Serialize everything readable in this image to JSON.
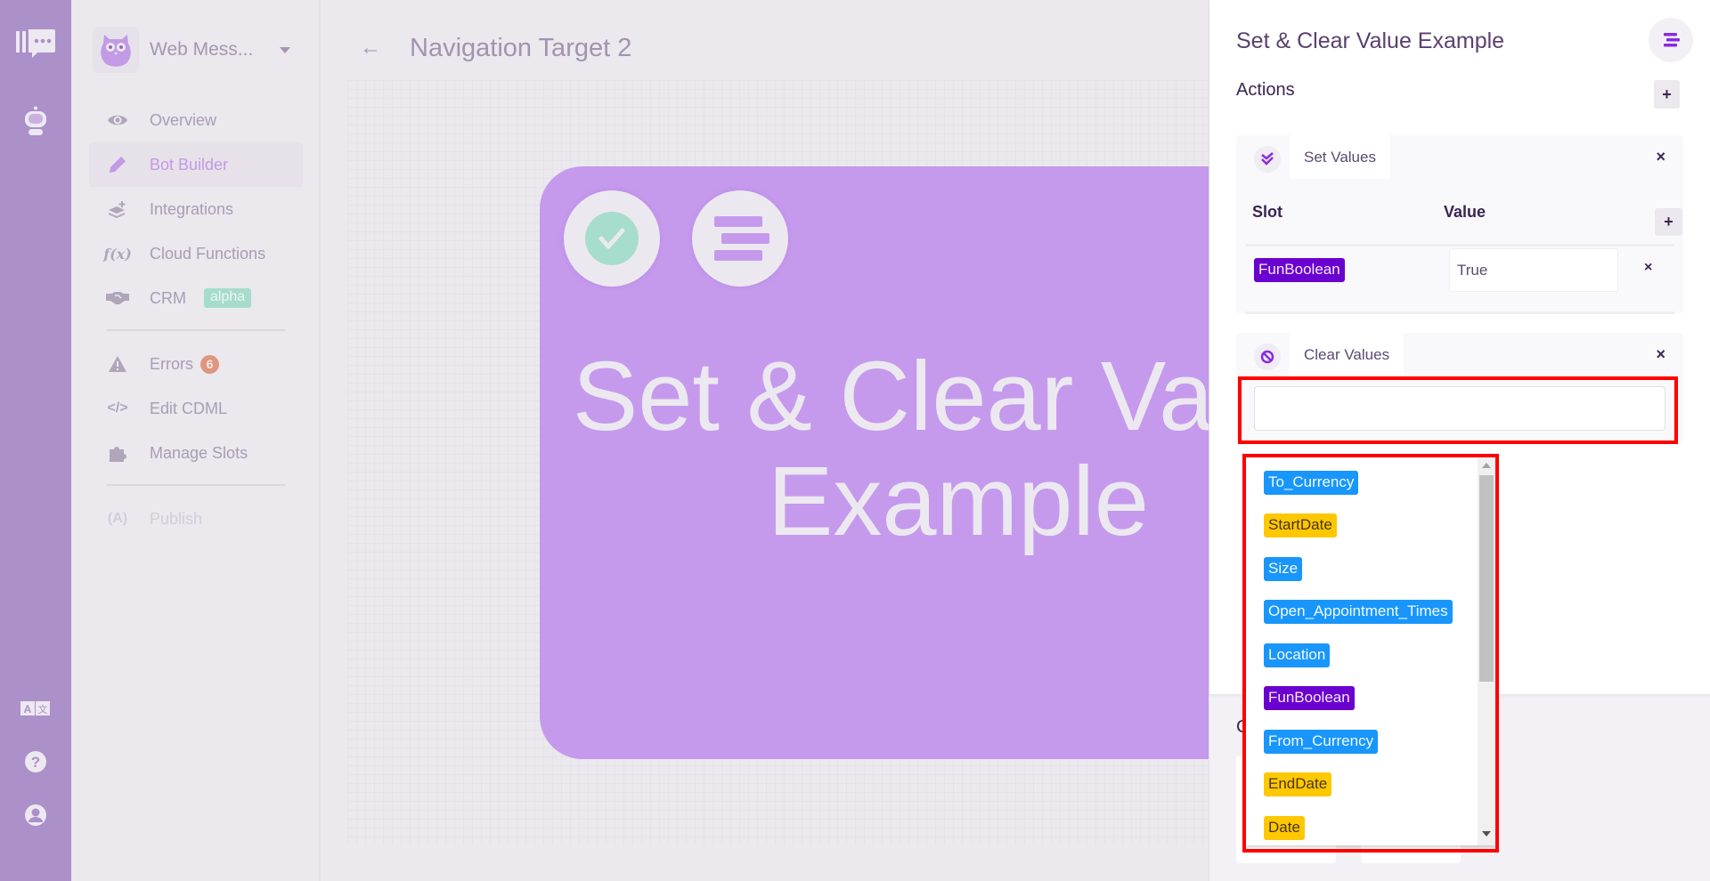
{
  "rail": {
    "icons": [
      "messaging-logo-icon",
      "bot-icon",
      "language-icon",
      "help-icon",
      "user-account-icon"
    ]
  },
  "sidebar": {
    "app_name": "Web Mess...",
    "items": [
      {
        "label": "Overview",
        "icon": "eye-icon",
        "glyph": "👁"
      },
      {
        "label": "Bot Builder",
        "icon": "pencil-icon",
        "glyph": "✎",
        "active": true
      },
      {
        "label": "Integrations",
        "icon": "layers-plus-icon",
        "glyph": "≋"
      },
      {
        "label": "Cloud Functions",
        "icon": "function-icon",
        "glyph": "f(x)"
      },
      {
        "label": "CRM",
        "icon": "handshake-icon",
        "glyph": "🤝",
        "badge": "alpha"
      },
      {
        "label": "Errors",
        "icon": "warning-icon",
        "glyph": "⚠",
        "count": "6"
      },
      {
        "label": "Edit CDML",
        "icon": "code-icon",
        "glyph": "</>"
      },
      {
        "label": "Manage Slots",
        "icon": "puzzle-icon",
        "glyph": "✚"
      },
      {
        "label": "Publish",
        "icon": "broadcast-icon",
        "glyph": "(A)",
        "disabled": true
      }
    ]
  },
  "header": {
    "back_glyph": "←",
    "title": "Navigation Target 2"
  },
  "canvas": {
    "node_title": "Set & Clear Value Example",
    "node_color": "#c59aed"
  },
  "panel": {
    "title": "Set & Clear Value Example",
    "actions_label": "Actions",
    "add_glyph": "+",
    "close_glyph": "×",
    "set_values": {
      "label": "Set Values",
      "col_slot": "Slot",
      "col_value": "Value",
      "rows": [
        {
          "slot": "FunBoolean",
          "value": "True"
        }
      ]
    },
    "clear_values": {
      "label": "Clear Values",
      "input_value": ""
    },
    "dropdown_options": [
      {
        "label": "To_Currency",
        "color": "blue"
      },
      {
        "label": "StartDate",
        "color": "yellow"
      },
      {
        "label": "Size",
        "color": "blue"
      },
      {
        "label": "Open_Appointment_Times",
        "color": "blue"
      },
      {
        "label": "Location",
        "color": "blue"
      },
      {
        "label": "FunBoolean",
        "color": "purple"
      },
      {
        "label": "From_Currency",
        "color": "blue"
      },
      {
        "label": "EndDate",
        "color": "yellow"
      },
      {
        "label": "Date",
        "color": "yellow"
      }
    ],
    "lower_label_partial": "C"
  },
  "colors": {
    "rail": "#ac90c9",
    "accent": "#8a2be2",
    "chip_blue": "#1896fb",
    "chip_yellow": "#fdc800",
    "chip_purple": "#6a00d0",
    "highlight": "#ff0000"
  }
}
